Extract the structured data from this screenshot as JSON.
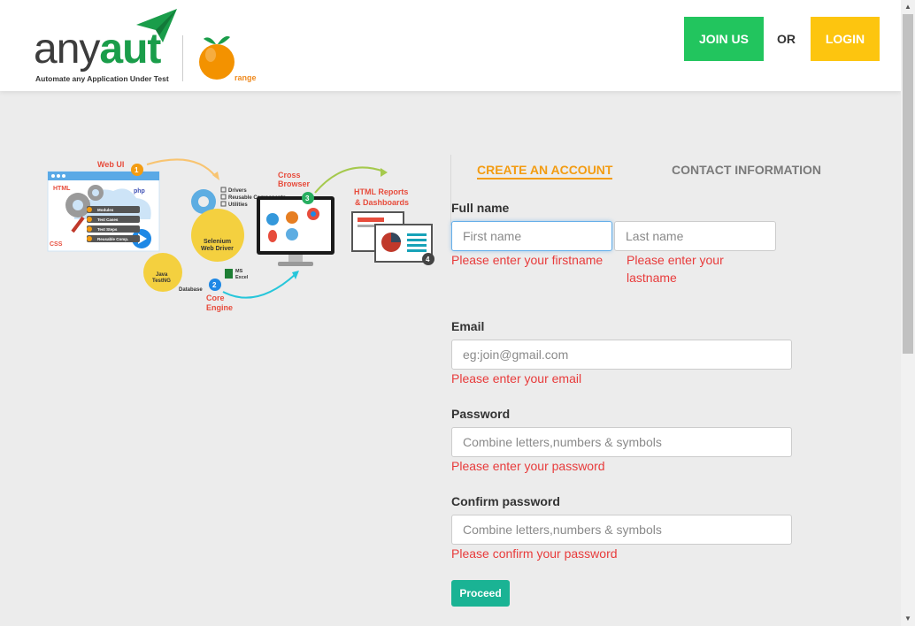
{
  "header": {
    "logo": {
      "word_any": "any",
      "word_aut": "aut",
      "tagline": "Automate any Application Under Test",
      "partner_text": "range"
    },
    "join_label": "JOIN US",
    "or_label": "OR",
    "login_label": "LOGIN"
  },
  "illustration": {
    "step1": "Web UI",
    "step2_line1": "Core",
    "step2_line2": "Engine",
    "step3_line1": "Cross",
    "step3_line2": "Browser",
    "step4_line1": "HTML Reports",
    "step4_line2": "& Dashboards",
    "html_label": "HTML",
    "css_label": "CSS",
    "php_label": "php",
    "drivers": "Drivers",
    "reusable": "Reusable Components",
    "utilities": "Utilities",
    "selenium_line1": "Selenium",
    "selenium_line2": "Web Driver",
    "java_line1": "Java",
    "java_line2": "TestNG",
    "database": "Database",
    "ms_line1": "MS",
    "ms_line2": "Excel",
    "list_items": [
      "Modules",
      "Test Cases",
      "Test Steps",
      "Reusable Comp."
    ],
    "badges": [
      "1",
      "2",
      "3",
      "4"
    ]
  },
  "tabs": {
    "create": "CREATE AN ACCOUNT",
    "contact": "CONTACT INFORMATION"
  },
  "form": {
    "fullname_label": "Full name",
    "firstname_placeholder": "First name",
    "lastname_placeholder": "Last name",
    "firstname_error": "Please enter your firstname",
    "lastname_error_line1": "Please enter your",
    "lastname_error_line2": "lastname",
    "email_label": "Email",
    "email_placeholder": "eg:join@gmail.com",
    "email_error": "Please enter your email",
    "password_label": "Password",
    "password_placeholder": "Combine letters,numbers & symbols",
    "password_error": "Please enter your password",
    "confirm_label": "Confirm password",
    "confirm_placeholder": "Combine letters,numbers & symbols",
    "confirm_error": "Please confirm your password",
    "proceed_label": "Proceed"
  }
}
